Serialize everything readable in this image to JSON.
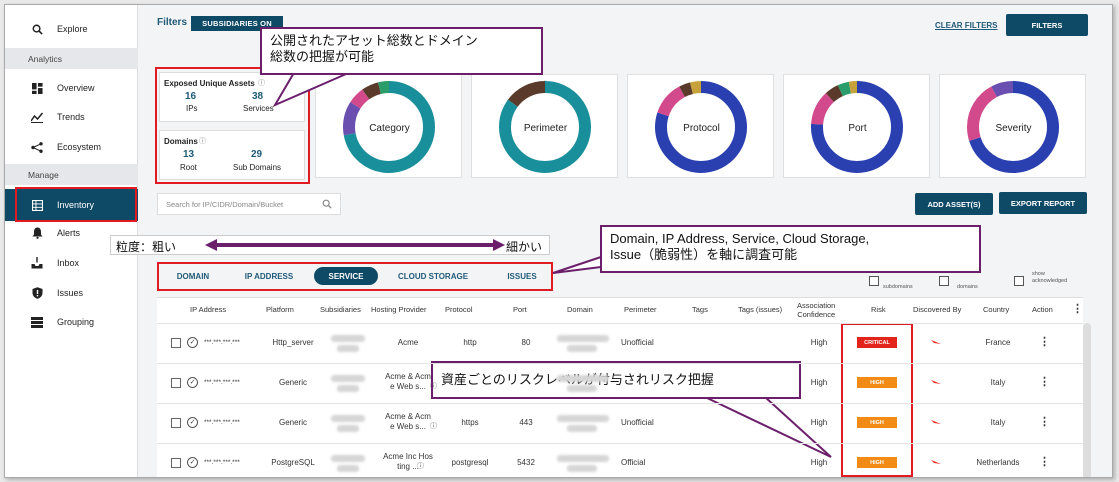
{
  "sidebar": {
    "explore": "Explore",
    "analytics": "Analytics",
    "overview": "Overview",
    "trends": "Trends",
    "ecosystem": "Ecosystem",
    "manage": "Manage",
    "inventory": "Inventory",
    "alerts": "Alerts",
    "inbox": "Inbox",
    "issues": "Issues",
    "grouping": "Grouping"
  },
  "header": {
    "filters": "Filters",
    "subsidiaries": "SUBSIDIARIES ON",
    "clear_filters": "CLEAR FILTERS",
    "filters_button": "FILTERS"
  },
  "assets": {
    "title": "Exposed Unique Assets",
    "ips_value": "16",
    "ips_label": "IPs",
    "services_value": "38",
    "services_label": "Services"
  },
  "domains": {
    "title": "Domains",
    "root_value": "13",
    "root_label": "Root",
    "sub_value": "29",
    "sub_label": "Sub Domains"
  },
  "donuts": [
    {
      "label": "Category",
      "segments": [
        [
          "#1a8f9c",
          0.72
        ],
        [
          "#6a4fb0",
          0.12
        ],
        [
          "#d24a8c",
          0.06
        ],
        [
          "#5a3a2a",
          0.06
        ],
        [
          "#2b9d6b",
          0.04
        ]
      ]
    },
    {
      "label": "Perimeter",
      "segments": [
        [
          "#1a8f9c",
          0.85
        ],
        [
          "#5a3a2a",
          0.15
        ]
      ]
    },
    {
      "label": "Protocol",
      "segments": [
        [
          "#2a3fb0",
          0.8
        ],
        [
          "#d24a8c",
          0.12
        ],
        [
          "#5a3a2a",
          0.04
        ],
        [
          "#c7a23a",
          0.04
        ]
      ]
    },
    {
      "label": "Port",
      "segments": [
        [
          "#2a3fb0",
          0.76
        ],
        [
          "#d24a8c",
          0.12
        ],
        [
          "#5a3a2a",
          0.05
        ],
        [
          "#2b9d6b",
          0.04
        ],
        [
          "#c7a23a",
          0.03
        ]
      ]
    },
    {
      "label": "Severity",
      "segments": [
        [
          "#2a3fb0",
          0.7
        ],
        [
          "#d24a8c",
          0.22
        ],
        [
          "#6a4fb0",
          0.08
        ]
      ]
    }
  ],
  "actions": {
    "add_assets": "ADD ASSET(S)",
    "export_report": "EXPORT REPORT",
    "search_placeholder": "Search for IP/CIDR/Domain/Bucket"
  },
  "tabs": [
    "DOMAIN",
    "IP ADDRESS",
    "SERVICE",
    "CLOUD STORAGE",
    "ISSUES"
  ],
  "toggles": {
    "subdomains": "subdomains",
    "domains": "domains",
    "show_acknowledged": "show\nacknowledged"
  },
  "columns": [
    "IP Address",
    "Platform",
    "Subsidiaries",
    "Hosting Provider",
    "Protocol",
    "Port",
    "Domain",
    "Perimeter",
    "Tags",
    "Tags (issues)",
    "Association\nConfidence",
    "Risk",
    "Discovered By",
    "Country",
    "Action"
  ],
  "rows": [
    {
      "ip": "***.***.***.***",
      "platform": "Http_server",
      "hosting": "Acme",
      "protocol": "http",
      "port": "80",
      "perimeter": "Unofficial",
      "confidence": "High",
      "risk": "CRITICAL",
      "country": "France"
    },
    {
      "ip": "***.***.***.***",
      "platform": "Generic",
      "hosting": "Acme & Acm\ne Web s...",
      "protocol": "",
      "port": "",
      "perimeter": "",
      "confidence": "High",
      "risk": "HIGH",
      "country": "Italy"
    },
    {
      "ip": "***.***.***.***",
      "platform": "Generic",
      "hosting": "Acme & Acm\ne Web s...",
      "protocol": "https",
      "port": "443",
      "perimeter": "Unofficial",
      "confidence": "High",
      "risk": "HIGH",
      "country": "Italy"
    },
    {
      "ip": "***.***.***.***",
      "platform": "PostgreSQL",
      "hosting": "Acme Inc Hos\nting ...",
      "protocol": "postgresql",
      "port": "5432",
      "perimeter": "Official",
      "confidence": "High",
      "risk": "HIGH",
      "country": "Netherlands"
    }
  ],
  "colors": {
    "critical": "#e3241b",
    "high": "#f28a16",
    "accent": "#0e4a66",
    "callout_border": "#6b1f6b"
  },
  "callouts": {
    "top": "公開されたアセット総数とドメイン\n総数の把握が可能",
    "right": "Domain, IP Address, Service, Cloud Storage,\nIssue（脆弱性）を軸に調査可能",
    "bottom": "資産ごとのリスクレベルが付与されリスク把握",
    "granularity_left": "粒度：粗い",
    "granularity_right": "細かい"
  }
}
